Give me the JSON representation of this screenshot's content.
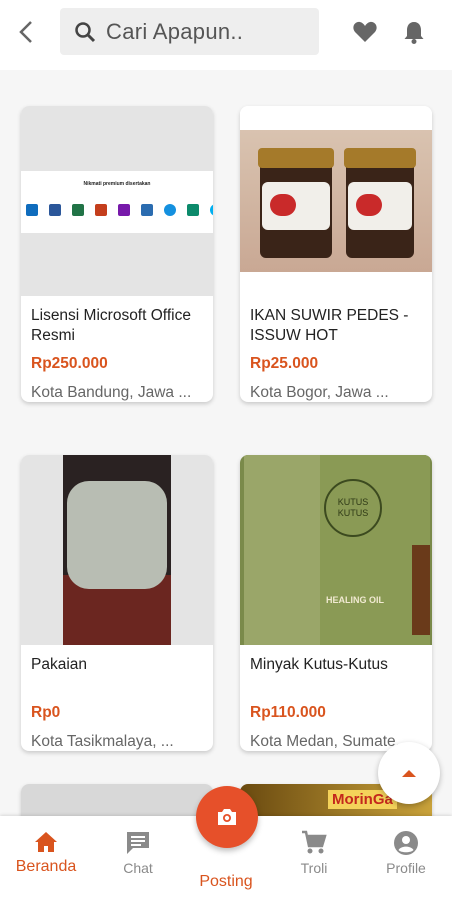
{
  "header": {
    "search_placeholder": "Cari Apapun.."
  },
  "products": [
    {
      "title": "Lisensi Microsoft Office Resmi",
      "price": "Rp250.000",
      "location": "Kota Bandung, Jawa ...",
      "image_caption": "Nikmati premium disertakan"
    },
    {
      "title": "IKAN SUWIR PEDES - ISSUW HOT",
      "price": "Rp25.000",
      "location": "Kota Bogor, Jawa ..."
    },
    {
      "title": "Pakaian",
      "price": "Rp0",
      "location": "Kota Tasikmalaya, ..."
    },
    {
      "title": "Minyak Kutus-Kutus",
      "price": "Rp110.000",
      "location": "Kota Medan, Sumate...",
      "label_top": "KUTUS KUTUS",
      "label_bottom": "HEALING OIL"
    },
    {
      "image_text": "MorinGa"
    }
  ],
  "nav": {
    "beranda": "Beranda",
    "chat": "Chat",
    "posting": "Posting",
    "troli": "Troli",
    "profile": "Profile"
  },
  "colors": {
    "accent": "#d9541e",
    "fab": "#e6502a"
  }
}
